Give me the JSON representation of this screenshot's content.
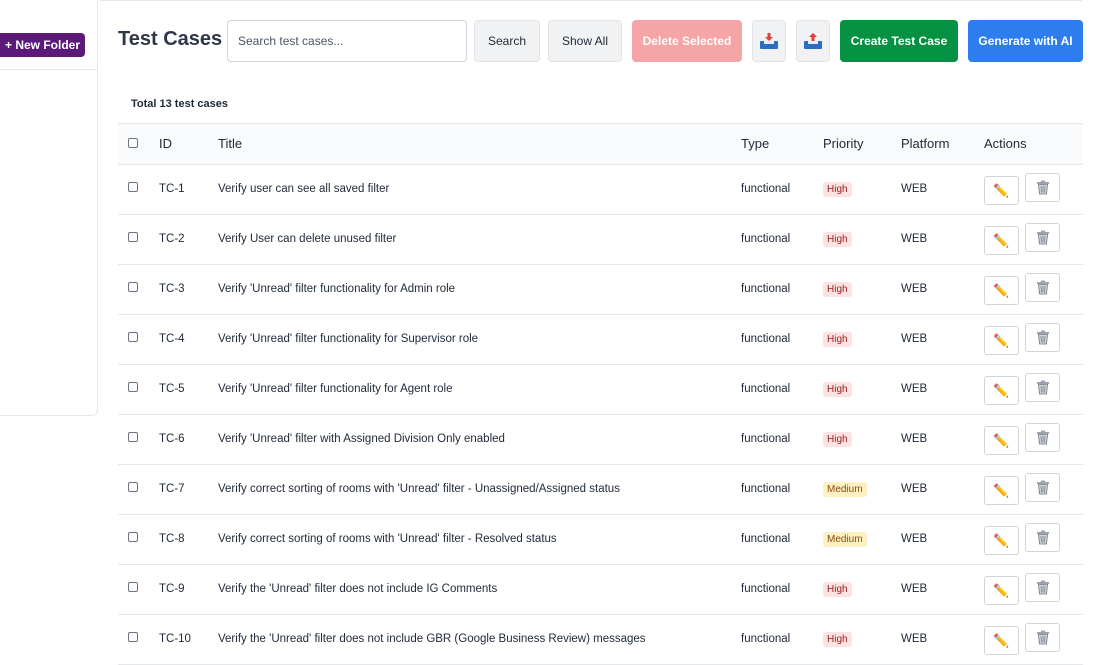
{
  "sidebar": {
    "new_folder_label": "+ New Folder"
  },
  "header": {
    "title": "Test Cases",
    "search_placeholder": "Search test cases...",
    "search_label": "Search",
    "show_all_label": "Show All",
    "delete_selected_label": "Delete Selected",
    "import_icon": "inbox-tray-icon",
    "export_icon": "inbox-tray-icon",
    "create_label": "Create Test Case",
    "ai_label": "Generate with AI"
  },
  "table": {
    "total_label": "Total 13 test cases",
    "columns": [
      "ID",
      "Title",
      "Type",
      "Priority",
      "Platform",
      "Actions"
    ],
    "rows": [
      {
        "id": "TC-1",
        "title": "Verify user can see all saved filter",
        "type": "functional",
        "priority": "High",
        "platform": "WEB"
      },
      {
        "id": "TC-2",
        "title": "Verify User can delete unused filter",
        "type": "functional",
        "priority": "High",
        "platform": "WEB"
      },
      {
        "id": "TC-3",
        "title": "Verify 'Unread' filter functionality for Admin role",
        "type": "functional",
        "priority": "High",
        "platform": "WEB"
      },
      {
        "id": "TC-4",
        "title": "Verify 'Unread' filter functionality for Supervisor role",
        "type": "functional",
        "priority": "High",
        "platform": "WEB"
      },
      {
        "id": "TC-5",
        "title": "Verify 'Unread' filter functionality for Agent role",
        "type": "functional",
        "priority": "High",
        "platform": "WEB"
      },
      {
        "id": "TC-6",
        "title": "Verify 'Unread' filter with Assigned Division Only enabled",
        "type": "functional",
        "priority": "High",
        "platform": "WEB"
      },
      {
        "id": "TC-7",
        "title": "Verify correct sorting of rooms with 'Unread' filter - Unassigned/Assigned status",
        "type": "functional",
        "priority": "Medium",
        "platform": "WEB"
      },
      {
        "id": "TC-8",
        "title": "Verify correct sorting of rooms with 'Unread' filter - Resolved status",
        "type": "functional",
        "priority": "Medium",
        "platform": "WEB"
      },
      {
        "id": "TC-9",
        "title": "Verify the 'Unread' filter does not include IG Comments",
        "type": "functional",
        "priority": "High",
        "platform": "WEB"
      },
      {
        "id": "TC-10",
        "title": "Verify the 'Unread' filter does not include GBR (Google Business Review) messages",
        "type": "functional",
        "priority": "High",
        "platform": "WEB"
      }
    ],
    "edit_icon": "pencil-icon",
    "delete_icon": "trash-icon"
  }
}
